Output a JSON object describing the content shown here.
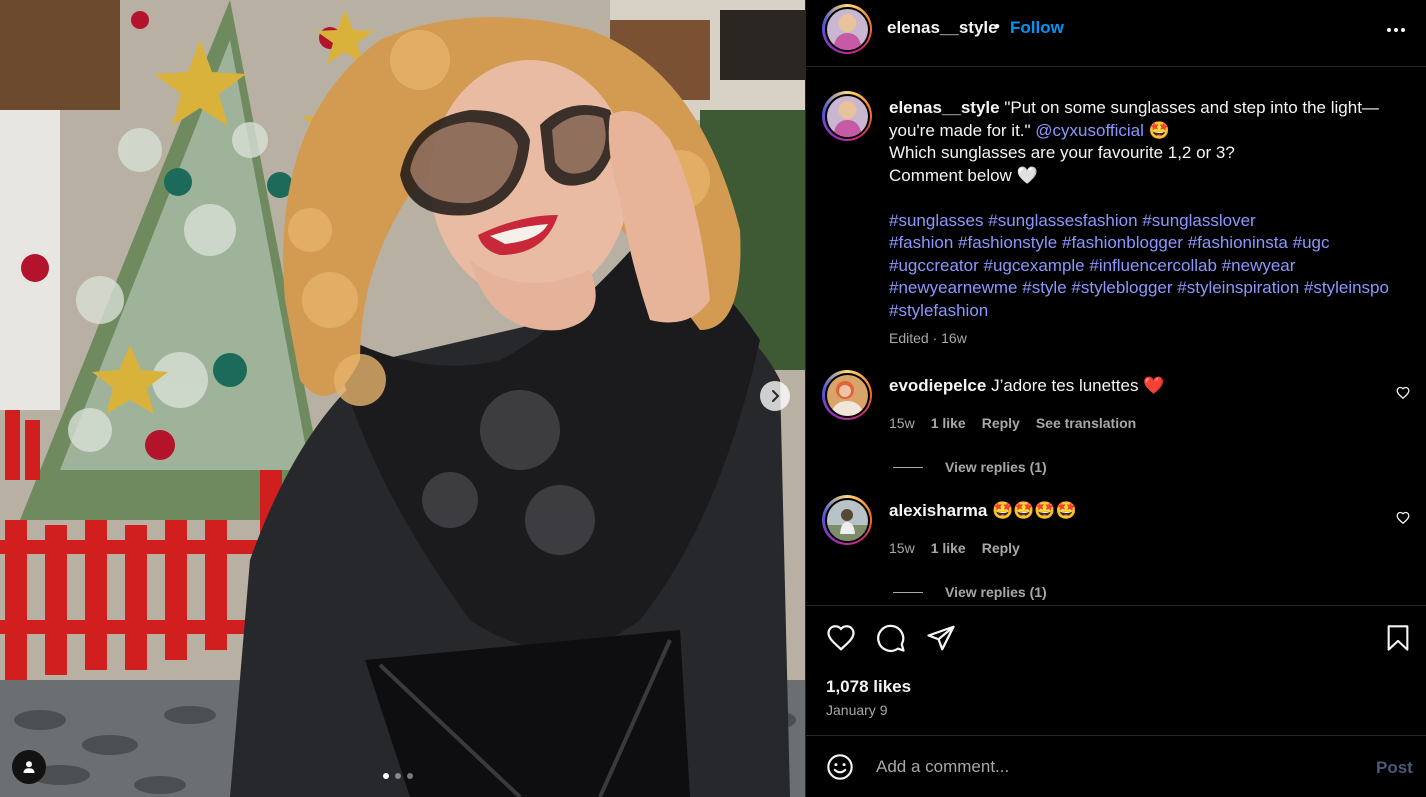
{
  "post": {
    "username": "elenas__style",
    "follow_label": "Follow",
    "separator": "•",
    "caption": {
      "text_1": "\"Put on some sunglasses and step into the light—you're made for it.\"",
      "mention": "@cyxusofficial",
      "emoji_1": "🤩",
      "line_2": "Which sunglasses are your favourite 1,2 or 3?",
      "line_3": "Comment below 🤍",
      "hashtags": [
        "#sunglasses",
        "#sunglassesfashion",
        "#sunglasslover",
        "#fashion",
        "#fashionstyle",
        "#fashionblogger",
        "#fashioninsta",
        "#ugc",
        "#ugccreator",
        "#ugcexample",
        "#influencercollab",
        "#newyear",
        "#newyearnewme",
        "#style",
        "#styleblogger",
        "#styleinspiration",
        "#styleinspo",
        "#stylefashion"
      ],
      "edited": "Edited · 16w"
    },
    "comments": [
      {
        "username": "evodiepelce",
        "text": "J’adore tes lunettes ❤️",
        "age": "15w",
        "likes": "1 like",
        "reply": "Reply",
        "translate": "See translation",
        "view_replies": "View replies (1)"
      },
      {
        "username": "alexisharma",
        "text": "🤩🤩🤩🤩",
        "age": "15w",
        "likes": "1 like",
        "reply": "Reply",
        "view_replies": "View replies (1)"
      }
    ],
    "likes": "1,078 likes",
    "date": "January 9",
    "add_comment_placeholder": "Add a comment...",
    "post_label": "Post",
    "carousel": {
      "slide_count": 3,
      "active_index": 0
    }
  },
  "icons": {
    "more": "more-horizontal-icon",
    "like": "heart-icon",
    "comment": "comment-bubble-icon",
    "share": "paper-plane-icon",
    "save": "bookmark-icon",
    "emoji": "emoji-smiley-icon",
    "next": "chevron-right-icon",
    "user_tag": "person-icon"
  },
  "colors": {
    "accent": "#0095f6",
    "link": "#8b97ff",
    "muted": "#a8a8a8",
    "like_red": "#ff3040"
  }
}
